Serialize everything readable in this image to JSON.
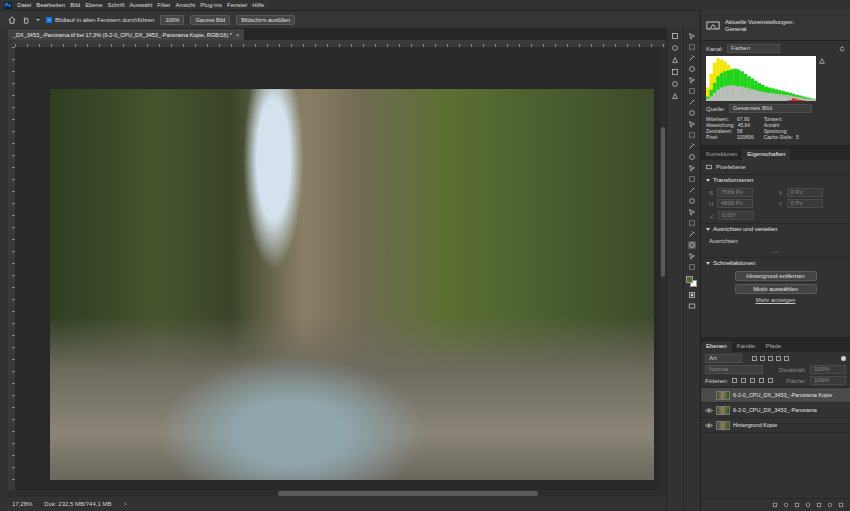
{
  "menu_bar": {
    "logo": "Ps",
    "items": [
      "Datei",
      "Bearbeiten",
      "Bild",
      "Ebene",
      "Schrift",
      "Auswahl",
      "Filter",
      "Ansicht",
      "Plug-ins",
      "Fenster",
      "Hilfe"
    ]
  },
  "options_bar": {
    "scroll_all": {
      "label": "Bildlauf in allen Fenstern durchführen",
      "checked": true
    },
    "buttons": [
      "100%",
      "Ganzes Bild",
      "Bildschirm ausfüllen"
    ]
  },
  "workspace": {
    "label": "Aktuelle Voreinstellungen:",
    "value": "General"
  },
  "document_tab": {
    "title": "_DX_3453_-Panorama.tif bei 17,3% (6-2-0_CPU_DX_3453_-Panorama Kopie, RGB/16) *",
    "close": "×"
  },
  "status_bar": {
    "zoom": "17,28%",
    "info": "Dok: 232,5 MB/744,1 MB",
    "arrow": ">"
  },
  "histogram": {
    "channel_label": "Kanal:",
    "channel": "Farben",
    "source_label": "Quelle:",
    "source": "Gesamtes Bild",
    "series": [
      {
        "color": "#f2e600",
        "values": [
          30,
          60,
          85,
          95,
          92,
          88,
          80,
          72,
          66,
          60,
          55,
          50,
          46,
          42,
          38,
          35,
          32,
          30,
          28,
          26,
          24,
          22,
          20,
          18,
          16,
          14,
          12,
          10,
          8,
          6,
          5,
          4
        ]
      },
      {
        "color": "#1fd41f",
        "values": [
          10,
          25,
          40,
          55,
          62,
          66,
          68,
          70,
          72,
          70,
          66,
          60,
          55,
          50,
          45,
          40,
          36,
          32,
          30,
          28,
          26,
          24,
          22,
          20,
          18,
          16,
          14,
          12,
          10,
          8,
          6,
          4
        ]
      },
      {
        "color": "#bdbdbd",
        "values": [
          5,
          10,
          18,
          25,
          30,
          33,
          34,
          35,
          34,
          33,
          32,
          30,
          28,
          26,
          24,
          22,
          20,
          19,
          18,
          17,
          16,
          15,
          14,
          13,
          12,
          10,
          9,
          8,
          6,
          5,
          4,
          3
        ]
      },
      {
        "color": "#e8261e",
        "values": [
          0,
          0,
          0,
          0,
          0,
          0,
          0,
          0,
          0,
          0,
          0,
          0,
          0,
          0,
          0,
          0,
          0,
          0,
          0,
          0,
          0,
          0,
          0,
          0,
          2,
          6,
          4,
          2,
          1,
          0,
          0,
          0
        ]
      }
    ],
    "stats_left": [
      {
        "label": "Mittelwert:",
        "value": "67,90"
      },
      {
        "label": "Abweichung:",
        "value": "45,64"
      },
      {
        "label": "Zentralwert:",
        "value": "58"
      },
      {
        "label": "Pixel:",
        "value": "100896"
      }
    ],
    "stats_right": [
      {
        "label": "Tonwert:",
        "value": ""
      },
      {
        "label": "Anzahl:",
        "value": ""
      },
      {
        "label": "Spreizung:",
        "value": ""
      },
      {
        "label": "Cache-Stufe:",
        "value": "5"
      }
    ]
  },
  "properties": {
    "tabs": [
      {
        "label": "Korrekturen",
        "selected": false
      },
      {
        "label": "Eigenschaften",
        "selected": true
      }
    ],
    "layer_kind": "Pixelebene",
    "transform": {
      "title": "Transformieren",
      "disabled": true,
      "fields": [
        {
          "label": "B",
          "value": "7569 Px"
        },
        {
          "label": "X",
          "value": "0 Px"
        },
        {
          "label": "H",
          "value": "4800 Px"
        },
        {
          "label": "Y",
          "value": "0 Px"
        }
      ],
      "angle": "0,00°"
    },
    "align": {
      "title": "Ausrichten und verteilen",
      "label": "Ausrichten:",
      "more": "..."
    },
    "quick_actions": {
      "title": "Schnellaktionen",
      "buttons": [
        "Hintergrund entfernen",
        "Motiv auswählen"
      ],
      "link": "Mehr anzeigen"
    }
  },
  "layers_panel": {
    "tabs": [
      {
        "label": "Ebenen",
        "selected": true
      },
      {
        "label": "Kanäle",
        "selected": false
      },
      {
        "label": "Pfade",
        "selected": false
      }
    ],
    "filter": "Art",
    "blend_mode": "Normal",
    "opacity_label": "Deckkraft:",
    "opacity": "100%",
    "lock_label": "Fixieren:",
    "fill_label": "Fläche:",
    "fill": "100%",
    "layers": [
      {
        "name": "6-2-0_CPU_DX_3453_-Panorama Kopie",
        "visible": false,
        "selected": true
      },
      {
        "name": "6-2-0_CPU_DX_3453_-Panorama",
        "visible": true,
        "selected": false
      },
      {
        "name": "Hintergrund Kopie",
        "visible": true,
        "selected": false
      }
    ]
  },
  "swatches": [
    {
      "color": "#4b6a2f"
    },
    {
      "color": "#ffffff"
    }
  ]
}
